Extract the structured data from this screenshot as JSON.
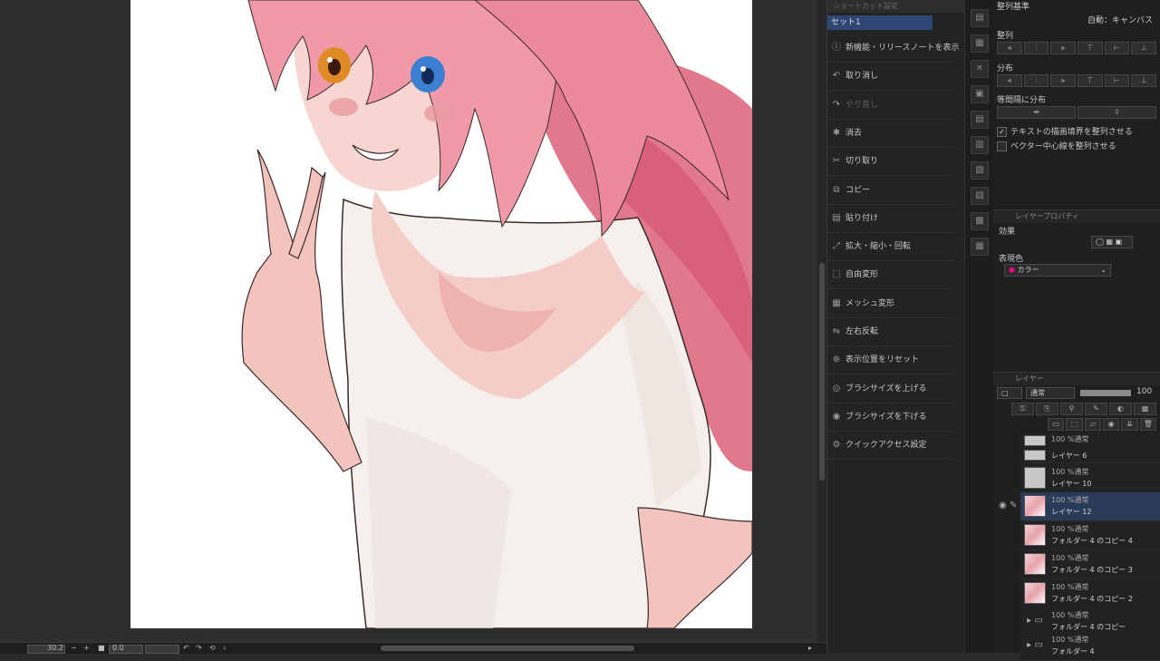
{
  "canvas": {
    "zoom": "30.2",
    "rotation": "0.0"
  },
  "command_bar": {
    "header": "ショートカット設定",
    "set_name": "セット1",
    "items": [
      {
        "label": "新機能・リリースノートを表示",
        "icon": "info-icon",
        "enabled": true
      },
      {
        "label": "取り消し",
        "icon": "undo-icon",
        "enabled": true
      },
      {
        "label": "やり直し",
        "icon": "redo-icon",
        "enabled": false
      },
      {
        "label": "消去",
        "icon": "clear-icon",
        "enabled": true
      },
      {
        "label": "切り取り",
        "icon": "scissors-icon",
        "enabled": true
      },
      {
        "label": "コピー",
        "icon": "copy-icon",
        "enabled": true
      },
      {
        "label": "貼り付け",
        "icon": "paste-icon",
        "enabled": true
      },
      {
        "label": "拡大・縮小・回転",
        "icon": "transform-icon",
        "enabled": true
      },
      {
        "label": "自由変形",
        "icon": "free-transform-icon",
        "enabled": true
      },
      {
        "label": "メッシュ変形",
        "icon": "mesh-icon",
        "enabled": true
      },
      {
        "label": "左右反転",
        "icon": "flip-icon",
        "enabled": true
      },
      {
        "label": "表示位置をリセット",
        "icon": "reset-view-icon",
        "enabled": true
      },
      {
        "label": "ブラシサイズを上げる",
        "icon": "brush-up-icon",
        "enabled": true
      },
      {
        "label": "ブラシサイズを下げる",
        "icon": "brush-down-icon",
        "enabled": true
      },
      {
        "label": "クイックアクセス設定",
        "icon": "gear-icon",
        "enabled": true
      }
    ]
  },
  "align_panel": {
    "base_label": "整列基準",
    "base_value": "自動：キャンバス",
    "align_label": "整列",
    "distribute_label": "分布",
    "equal_spacing_label": "等間隔に分布",
    "check_text_bounds": "テキストの描画境界を整列させる",
    "check_text_bounds_on": true,
    "check_vector_center": "ベクター中心線を整列させる",
    "check_vector_center_on": false
  },
  "layer_property": {
    "title": "レイヤープロパティ",
    "effect_label": "効果",
    "expression_label": "表現色",
    "expression_value": "カラー"
  },
  "layers_panel": {
    "title": "レイヤー",
    "blend_mode": "通常",
    "opacity": "100",
    "layers": [
      {
        "mode": "100 %通常",
        "name": "",
        "thumb": "gray"
      },
      {
        "mode": "",
        "name": "レイヤー 6",
        "thumb": "gray"
      },
      {
        "mode": "100 %通常",
        "name": "レイヤー 10",
        "thumb": "gray"
      },
      {
        "mode": "100 %通常",
        "name": "レイヤー 12",
        "thumb": "pink",
        "selected": true
      },
      {
        "mode": "100 %通常",
        "name": "フォルダー 4 のコピー 4",
        "thumb": "pink"
      },
      {
        "mode": "100 %通常",
        "name": "フォルダー 4 のコピー 3",
        "thumb": "pink"
      },
      {
        "mode": "100 %通常",
        "name": "フォルダー 4 のコピー 2",
        "thumb": "pink"
      },
      {
        "mode": "100 %通常",
        "name": "フォルダー 4 のコピー",
        "thumb": "folder"
      },
      {
        "mode": "100 %通常",
        "name": "フォルダー 4",
        "thumb": "folder"
      }
    ]
  }
}
